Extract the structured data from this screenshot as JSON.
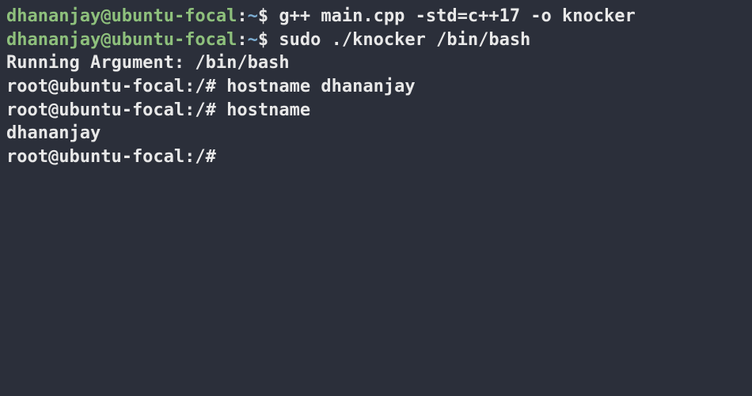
{
  "lines": [
    {
      "user": "dhananjay",
      "host": "ubuntu-focal",
      "path": "~",
      "sigil": "$",
      "cmd": "g++ main.cpp -std=c++17 -o knocker"
    },
    {
      "user": "dhananjay",
      "host": "ubuntu-focal",
      "path": "~",
      "sigil": "$",
      "cmd": "sudo ./knocker /bin/bash"
    },
    {
      "text": "Running Argument: /bin/bash"
    },
    {
      "prompt": "root@ubuntu-focal:/#",
      "cmd": "hostname dhananjay"
    },
    {
      "prompt": "root@ubuntu-focal:/#",
      "cmd": "hostname"
    },
    {
      "text": "dhananjay"
    },
    {
      "prompt": "root@ubuntu-focal:/#",
      "cmd": ""
    }
  ]
}
